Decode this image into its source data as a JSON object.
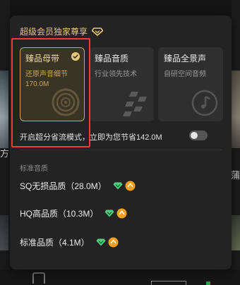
{
  "app": {
    "left_edge_text": "方",
    "right_edge_text": "蒲"
  },
  "popup": {
    "header_title": "超级会员独家尊享",
    "cards": [
      {
        "title": "臻品母带",
        "subtitle": "还原声音细节",
        "size": "170.0M",
        "selected": true
      },
      {
        "title": "臻品音质",
        "subtitle": "行业领先技术",
        "selected": false
      },
      {
        "title": "臻品全景声",
        "subtitle": "自研空间音频",
        "selected": false
      }
    ],
    "toggle": {
      "label": "开启超分省流模式，立即为您节省142.0M",
      "on": false
    },
    "section_label": "标准音质",
    "qualities": [
      {
        "label": "SQ无损品质（28.0M）"
      },
      {
        "label": "HQ高品质（10.3M）"
      },
      {
        "label": "标准品质（4.1M）"
      }
    ]
  },
  "colors": {
    "accent_gold": "#e8c77a",
    "vip_green": "#4ccf7a",
    "highlight_red": "#ef3b3b"
  },
  "icons": [
    "diamond-icon",
    "check-icon",
    "vinyl-record-icon",
    "checker-pattern-icon",
    "music-note-icon",
    "vip-green-diamond-icon",
    "gold-badge-icon",
    "toggle-switch"
  ]
}
